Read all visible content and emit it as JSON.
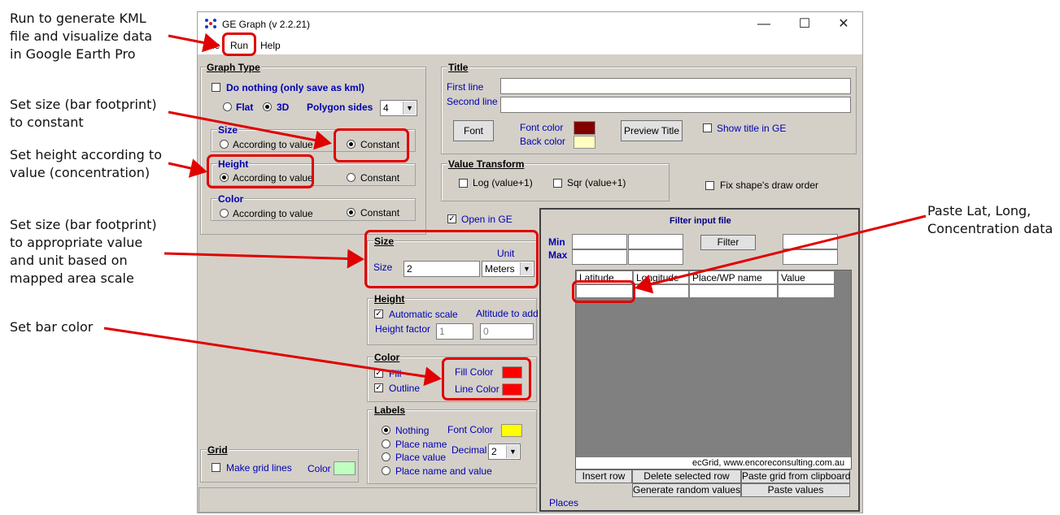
{
  "annotations": {
    "run": "Run to generate KML\nfile and visualize data\nin Google Earth Pro",
    "size_constant": "Set size (bar footprint)\nto constant",
    "height_value": "Set height according to\nvalue (concentration)",
    "size_unit": "Set size (bar footprint)\nto appropriate value\nand unit based on\nmapped area scale",
    "bar_color": "Set bar color",
    "paste": "Paste Lat, Long,\nConcentration data"
  },
  "window": {
    "title": "GE Graph (v 2.2.21)",
    "minimize": "—",
    "maximize": "☐",
    "close": "✕"
  },
  "menu": {
    "file": "File",
    "run": "Run",
    "help": "Help"
  },
  "graph_type": {
    "legend": "Graph Type",
    "do_nothing": "Do nothing (only save as kml)",
    "flat": "Flat",
    "three_d": "3D",
    "polygon_sides_label": "Polygon sides",
    "polygon_sides_value": "4",
    "size": {
      "legend": "Size",
      "according": "According to value",
      "constant": "Constant"
    },
    "height": {
      "legend": "Height",
      "according": "According to value",
      "constant": "Constant"
    },
    "color": {
      "legend": "Color",
      "according": "According to value",
      "constant": "Constant"
    }
  },
  "title_group": {
    "legend": "Title",
    "first_line": "First line",
    "second_line": "Second line",
    "font_button": "Font",
    "font_color": "Font color",
    "back_color": "Back color",
    "preview_button": "Preview Title",
    "show_title": "Show title in GE",
    "font_color_hex": "#800000",
    "back_color_hex": "#ffffc0"
  },
  "value_transform": {
    "legend": "Value Transform",
    "log": "Log (value+1)",
    "sqr": "Sqr (value+1)"
  },
  "fix_order": "Fix shape's draw order",
  "open_in_ge": "Open in GE",
  "size_group": {
    "legend": "Size",
    "unit_label": "Unit",
    "size_label": "Size",
    "size_value": "2",
    "unit_value": "Meters"
  },
  "height_group": {
    "legend": "Height",
    "auto_scale": "Automatic scale",
    "altitude_label": "Altitude to add",
    "factor_label": "Height factor",
    "factor_value": "1",
    "altitude_value": "0"
  },
  "color_group": {
    "legend": "Color",
    "fill": "Fill",
    "outline": "Outline",
    "fill_color": "Fill Color",
    "line_color": "Line  Color",
    "fill_hex": "#ff0000",
    "line_hex": "#ff0000"
  },
  "labels_group": {
    "legend": "Labels",
    "nothing": "Nothing",
    "place_name": "Place name",
    "place_value": "Place value",
    "place_name_value": "Place name and value",
    "font_color": "Font Color",
    "decimal": "Decimal",
    "decimal_value": "2",
    "font_hex": "#ffff00"
  },
  "grid_group": {
    "legend": "Grid",
    "make_lines": "Make grid lines",
    "color": "Color",
    "color_hex": "#c0ffc0"
  },
  "filter": {
    "title": "Filter input file",
    "min": "Min",
    "max": "Max",
    "filter_button": "Filter",
    "columns": [
      "Latitude",
      "Longitude",
      "Place/WP name",
      "Value"
    ],
    "credit": "ecGrid,  www.encoreconsulting.com.au",
    "insert_row": "Insert row",
    "delete_row": "Delete selected row",
    "paste_clipboard": "Paste grid from clipboard",
    "random_values": "Generate random values",
    "paste_values": "Paste values",
    "places": "Places"
  },
  "colors": {
    "highlight": "#e00000",
    "label_blue": "#0000b0"
  }
}
